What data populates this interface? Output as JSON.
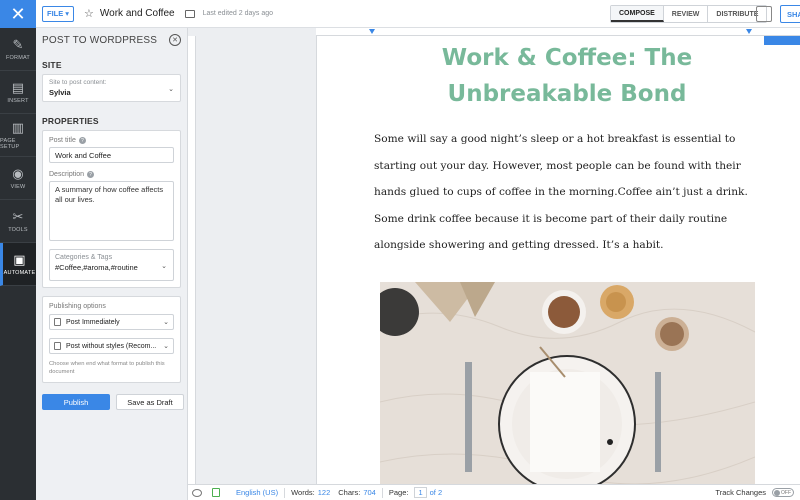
{
  "rail": {
    "items": [
      {
        "label": "FORMAT",
        "icon": "brush-icon"
      },
      {
        "label": "INSERT",
        "icon": "insert-doc-icon"
      },
      {
        "label": "PAGE SETUP",
        "icon": "page-setup-icon"
      },
      {
        "label": "VIEW",
        "icon": "eye-icon"
      },
      {
        "label": "TOOLS",
        "icon": "tools-icon"
      },
      {
        "label": "AUTOMATE",
        "icon": "automate-icon"
      }
    ],
    "active": "AUTOMATE"
  },
  "topbar": {
    "file_label": "FILE",
    "doc_title": "Work and Coffee",
    "last_edited": "Last edited 2 days ago",
    "modes": [
      "COMPOSE",
      "REVIEW",
      "DISTRIBUTE"
    ],
    "active_mode": "COMPOSE",
    "share_label": "SHA"
  },
  "panel": {
    "title": "POST TO WORDPRESS",
    "site_section": "SITE",
    "site_label": "Site to post content:",
    "site_value": "Sylvia",
    "properties_section": "PROPERTIES",
    "post_title_label": "Post title",
    "post_title_value": "Work and Coffee",
    "description_label": "Description",
    "description_value": "A summary of how coffee affects all our lives.",
    "categories_label": "Categories & Tags",
    "categories_value": "#Coffee,#aroma,#routine",
    "publishing_label": "Publishing options",
    "publish_option": "Post Immediately",
    "style_option": "Post without styles (Recom...",
    "publish_note": "Choose when end what format to publish this document",
    "publish_button": "Publish",
    "draft_button": "Save as Draft"
  },
  "document": {
    "heading": "Work & Coffee: The Unbreakable Bond",
    "paragraph": "Some will say a good night’s sleep or a hot breakfast is essential to starting out your day. However, most people can be found with their hands glued to cups of coffee in the morning.Coffee ain’t just a drink. Some drink coffee because it is become part of their daily routine alongside showering and getting dressed. It’s a habit."
  },
  "status": {
    "language": "English (US)",
    "words_label": "Words:",
    "words_value": "122",
    "chars_label": "Chars:",
    "chars_value": "704",
    "page_label": "Page:",
    "page_current": "1",
    "page_of": "of 2",
    "track_label": "Track Changes",
    "track_state": "OFF"
  },
  "colors": {
    "accent": "#3a87e6",
    "heading": "#78b99a",
    "rail_bg": "#2b2f33"
  }
}
